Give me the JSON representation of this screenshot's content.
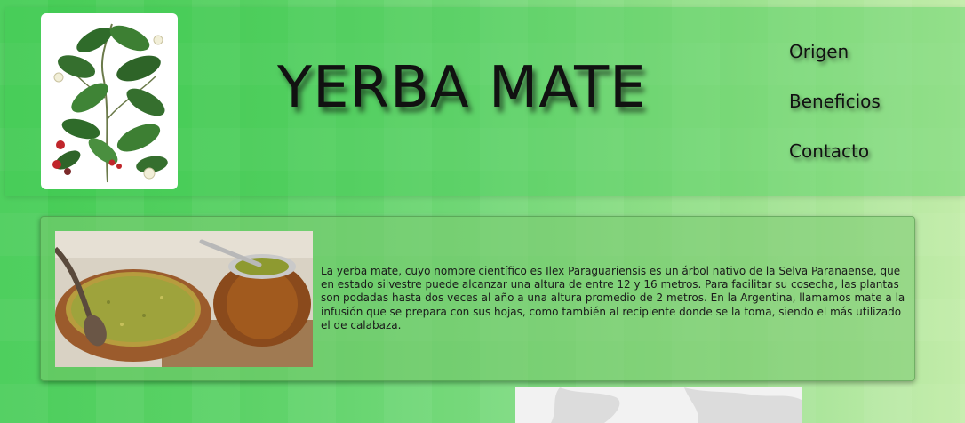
{
  "header": {
    "title": "YERBA MATE",
    "logo_icon": "yerba-mate-plant-illustration",
    "nav": [
      {
        "label": "Origen"
      },
      {
        "label": "Beneficios"
      },
      {
        "label": "Contacto"
      }
    ]
  },
  "intro": {
    "photo_icon": "mate-gourd-and-yerba-bowl-photo",
    "text": "La yerba mate, cuyo nombre científico es Ilex Paraguariensis es un árbol nativo de la Selva Paranaense, que en estado silvestre puede alcanzar una altura de entre 12 y 16 metros. Para facilitar su cosecha, las plantas son podadas hasta dos veces al año a una altura promedio de 2 metros. En la Argentina, llamamos mate a la infusión que se prepara con sus hojas, como también al recipiente donde se la toma, siendo el más utilizado el de calabaza."
  },
  "map": {
    "icon": "world-map-image"
  },
  "colors": {
    "background_start": "#45cc55",
    "background_end": "#c3ecaa",
    "text": "#111111"
  }
}
